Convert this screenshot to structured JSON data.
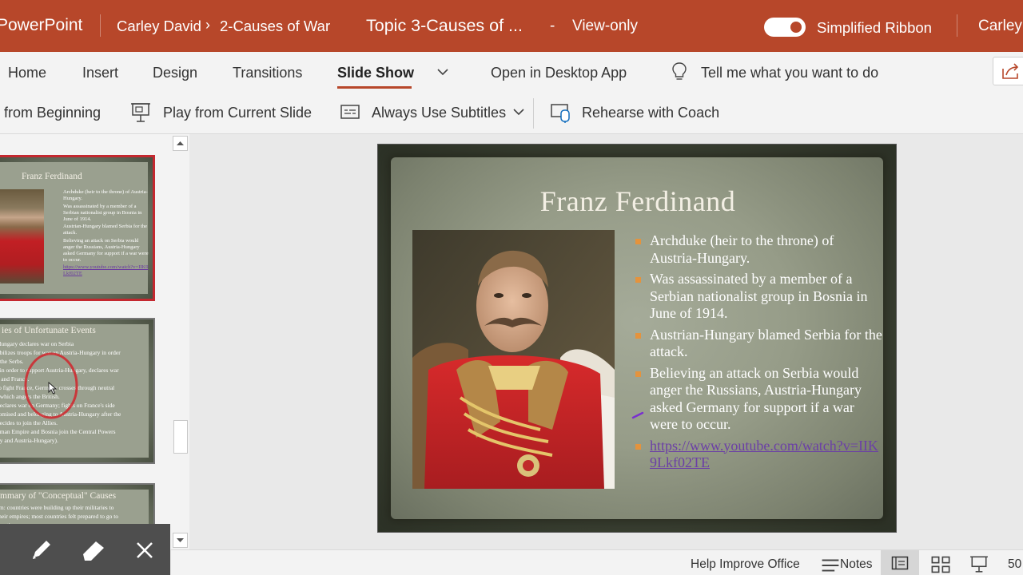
{
  "titlebar": {
    "app_name": "PowerPoint",
    "owner": "Carley David",
    "crumb_separator": "›",
    "folder": "2-Causes of War",
    "document_title": "Topic 3-Causes of ...",
    "dash": "-",
    "mode": "View-only",
    "simplified_ribbon_label": "Simplified Ribbon",
    "simplified_ribbon_on": true,
    "user": "Carley"
  },
  "tabs": {
    "items": [
      {
        "label": "Home"
      },
      {
        "label": "Insert"
      },
      {
        "label": "Design"
      },
      {
        "label": "Transitions"
      },
      {
        "label": "Slide Show"
      }
    ],
    "active": "Slide Show",
    "open_desktop": "Open in Desktop App",
    "tell_me": "Tell me what you want to do"
  },
  "commands": {
    "from_beginning": "from Beginning",
    "play_current": "Play from Current Slide",
    "subtitles": "Always Use Subtitles",
    "rehearse": "Rehearse with Coach"
  },
  "thumbnails": {
    "t1": {
      "title": "Franz Ferdinand",
      "lines": [
        "Archduke (heir to the throne) of Austria-Hungary.",
        "Was assassinated by a member of a Serbian nationalist group in Bosnia in June of 1914.",
        "Austrian-Hungary blamed Serbia for the attack.",
        "Believing an attack on Serbia would anger the Russians, Austria-Hungary asked Germany for support if a war were to occur."
      ],
      "link": "https://www.youtube.com/watch?v=IIK9Lkf02TE"
    },
    "t2": {
      "title": "ies of Unfortunate Events",
      "lines": [
        "Hungary declares war on Serbia",
        "obilizes troops for war on Austria-Hungary in order",
        "t the Serbs.",
        ", in order to support Austria-Hungary, declares war",
        "a and France.",
        "to fight France, Germany crosses through neutral",
        ", which angers the British.",
        "declares war on Germany; fights on France's side",
        "romised and belonging to Austria-Hungary after the",
        "decides to join the Allies.",
        "oman Empire and Bosnia join the Central Powers",
        "ny and Austria-Hungary)."
      ]
    },
    "t3": {
      "title": "mmary of \"Conceptual\" Causes",
      "lines": [
        "sm: countries were building up their militaries to",
        "their empires; most countries felt prepared to go to",
        "any time."
      ]
    }
  },
  "slide": {
    "title": "Franz Ferdinand",
    "bullets": [
      "Archduke (heir to the throne) of Austria-Hungary.",
      "Was assassinated by a member of a Serbian nationalist group in Bosnia in June of 1914.",
      "Austrian-Hungary blamed Serbia for the attack.",
      "Believing an attack on Serbia would anger the Russians, Austria-Hungary asked Germany for support if a war were to occur."
    ],
    "link": "https://www.youtube.com/watch?v=IIK9Lkf02TE"
  },
  "statusbar": {
    "help": "Help Improve Office",
    "notes": "Notes",
    "zoom": "50"
  },
  "colors": {
    "accent": "#b7472a",
    "bullet": "#e4933d",
    "link": "#6b3fa6"
  },
  "icons": {
    "pen": "pen-icon",
    "eraser": "eraser-icon",
    "close": "close-icon",
    "present": "present-icon",
    "subtitles": "subtitles-icon",
    "coach": "coach-icon",
    "bulb": "lightbulb-icon",
    "share": "share-icon"
  }
}
